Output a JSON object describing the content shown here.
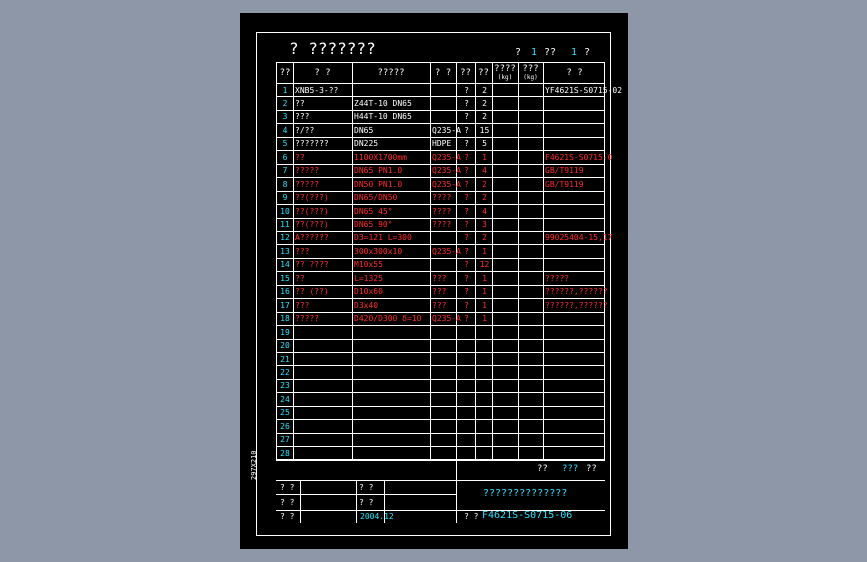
{
  "title": "? ???????",
  "title_right": {
    "a": "?",
    "b": "1",
    "c": "??",
    "d": "1",
    "e": "?"
  },
  "side_label": "297X210",
  "headers": [
    {
      "key": "no",
      "label": "??"
    },
    {
      "key": "code",
      "label": "?  ?"
    },
    {
      "key": "spec",
      "label": "?????"
    },
    {
      "key": "mat",
      "label": "?  ?"
    },
    {
      "key": "unit",
      "label": "??"
    },
    {
      "key": "qty",
      "label": "??"
    },
    {
      "key": "w1",
      "label": "????",
      "sub": "(kg)"
    },
    {
      "key": "w2",
      "label": "???",
      "sub": "(kg)"
    },
    {
      "key": "note",
      "label": "?      ?"
    }
  ],
  "rows": [
    {
      "no": "1",
      "code": "XNB5-3-??",
      "spec": "",
      "mat": "",
      "unit": "?",
      "qty": "2",
      "note": "YF4621S-S0715-02",
      "color": "white"
    },
    {
      "no": "2",
      "code": "??",
      "spec": "Z44T-10 DN65",
      "mat": "",
      "unit": "?",
      "qty": "2",
      "note": "",
      "color": "white"
    },
    {
      "no": "3",
      "code": "???",
      "spec": "H44T-10 DN65",
      "mat": "",
      "unit": "?",
      "qty": "2",
      "note": "",
      "color": "white"
    },
    {
      "no": "4",
      "code": "?/??",
      "spec": "DN65",
      "mat": "Q235-A",
      "unit": "?",
      "qty": "15",
      "note": "",
      "color": "white"
    },
    {
      "no": "5",
      "code": "???????",
      "spec": "DN225",
      "mat": "HDPE",
      "unit": "?",
      "qty": "5",
      "note": "",
      "color": "white"
    },
    {
      "no": "6",
      "code": "??",
      "spec": "1100X1700mm",
      "mat": "Q235-A",
      "unit": "?",
      "qty": "1",
      "note": "F4621S-S0715-0",
      "color": "red"
    },
    {
      "no": "7",
      "code": "?????",
      "spec": "DN65  PN1.0",
      "mat": "Q235-A",
      "unit": "?",
      "qty": "4",
      "note": "GB/T9119",
      "color": "red"
    },
    {
      "no": "8",
      "code": "?????",
      "spec": "DN50  PN1.0",
      "mat": "Q235-A",
      "unit": "?",
      "qty": "2",
      "note": "GB/T9119",
      "color": "red"
    },
    {
      "no": "9",
      "code": "??(???)",
      "spec": "DN65/DN50",
      "mat": "????",
      "unit": "?",
      "qty": "2",
      "note": "",
      "color": "red"
    },
    {
      "no": "10",
      "code": "??(???)",
      "spec": "DN65  45°",
      "mat": "????",
      "unit": "?",
      "qty": "4",
      "note": "",
      "color": "red"
    },
    {
      "no": "11",
      "code": "??(???)",
      "spec": "DN65  90°",
      "mat": "????",
      "unit": "?",
      "qty": "3",
      "note": "",
      "color": "red"
    },
    {
      "no": "12",
      "code": "A??????",
      "spec": "D3=121  L=300",
      "mat": "",
      "unit": "?",
      "qty": "2",
      "note": "99025404-15,17",
      "color": "red"
    },
    {
      "no": "13",
      "code": "???",
      "spec": "300x300x10",
      "mat": "Q235-A",
      "unit": "?",
      "qty": "1",
      "note": "",
      "color": "red"
    },
    {
      "no": "14",
      "code": "?? ????",
      "spec": "M10x55",
      "mat": "",
      "unit": "?",
      "qty": "12",
      "note": "",
      "color": "red"
    },
    {
      "no": "15",
      "code": "??",
      "spec": "L=1325",
      "mat": "???",
      "unit": "?",
      "qty": "1",
      "note": "?????",
      "color": "red"
    },
    {
      "no": "16",
      "code": "?? (??)",
      "spec": "D10x60",
      "mat": "???",
      "unit": "?",
      "qty": "1",
      "note": "??????,??????",
      "color": "red"
    },
    {
      "no": "17",
      "code": "???",
      "spec": "D3x40",
      "mat": "???",
      "unit": "?",
      "qty": "1",
      "note": "??????,??????",
      "color": "red"
    },
    {
      "no": "18",
      "code": "?????",
      "spec": "D420/D300   δ=10",
      "mat": "Q235-A",
      "unit": "?",
      "qty": "1",
      "note": "",
      "color": "red"
    },
    {
      "no": "19"
    },
    {
      "no": "20"
    },
    {
      "no": "21"
    },
    {
      "no": "22"
    },
    {
      "no": "23"
    },
    {
      "no": "24"
    },
    {
      "no": "25"
    },
    {
      "no": "26"
    },
    {
      "no": "27"
    },
    {
      "no": "28"
    }
  ],
  "title_block": {
    "tr1": "??",
    "tr2": "???",
    "tr3": "??",
    "l1": "?  ?",
    "l2": "?  ?",
    "l3": "?  ?",
    "m1": "?  ?",
    "m2": "?  ?",
    "date": "2004.12",
    "drawing_name": "??????????????",
    "dwg_label": "?  ?",
    "dwg_no": "F4621S-S0715-06"
  }
}
